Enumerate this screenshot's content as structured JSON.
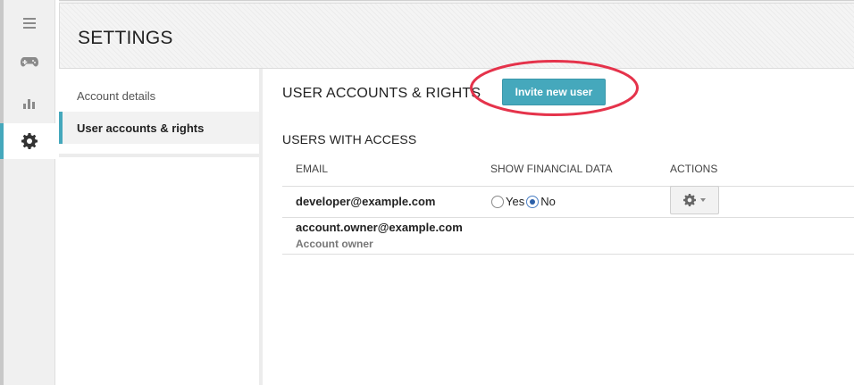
{
  "rail": {
    "items": [
      {
        "icon": "menu-icon",
        "active": false
      },
      {
        "icon": "gamepad-icon",
        "active": false
      },
      {
        "icon": "bar-chart-icon",
        "active": false
      },
      {
        "icon": "gear-icon",
        "active": true
      }
    ]
  },
  "header": {
    "title": "SETTINGS"
  },
  "sidenav": {
    "items": [
      {
        "label": "Account details"
      },
      {
        "label": "User accounts & rights"
      }
    ]
  },
  "main": {
    "section_title": "USER ACCOUNTS & RIGHTS",
    "invite_label": "Invite new user",
    "users_title": "USERS WITH ACCESS",
    "columns": [
      "EMAIL",
      "SHOW FINANCIAL DATA",
      "ACTIONS"
    ],
    "users": [
      {
        "email": "developer@example.com",
        "financial_yes": "Yes",
        "financial_no": "No",
        "selected": "No"
      },
      {
        "email": "account.owner@example.com",
        "role": "Account owner"
      }
    ]
  },
  "colors": {
    "accent": "#45a8bc",
    "highlight_ring": "#e5334b"
  }
}
